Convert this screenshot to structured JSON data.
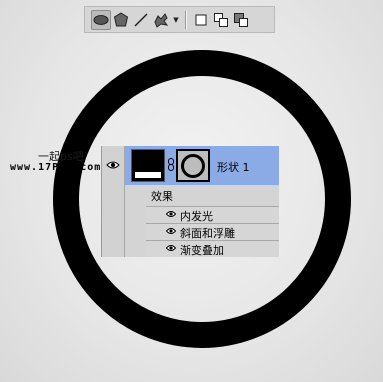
{
  "toolbar": {
    "tools": [
      {
        "icon": "ellipse-tool-icon",
        "active": true
      },
      {
        "icon": "polygon-tool-icon",
        "active": false
      },
      {
        "icon": "line-tool-icon",
        "active": false
      },
      {
        "icon": "custom-shape-tool-icon",
        "active": false
      }
    ],
    "modes": [
      {
        "icon": "new-layer-mode-icon"
      },
      {
        "icon": "add-mode-icon"
      },
      {
        "icon": "subtract-mode-icon"
      }
    ]
  },
  "canvas": {
    "ring_color": "#000000"
  },
  "layers_panel": {
    "selected_color": "#8aabe6",
    "layer": {
      "name": "形状 1"
    },
    "effects_label": "效果",
    "effects": [
      {
        "label": "内发光"
      },
      {
        "label": "斜面和浮雕"
      },
      {
        "label": "渐变叠加"
      }
    ]
  },
  "watermark": {
    "line1": "一起ps吧",
    "line2": "www.17PS8.com"
  }
}
